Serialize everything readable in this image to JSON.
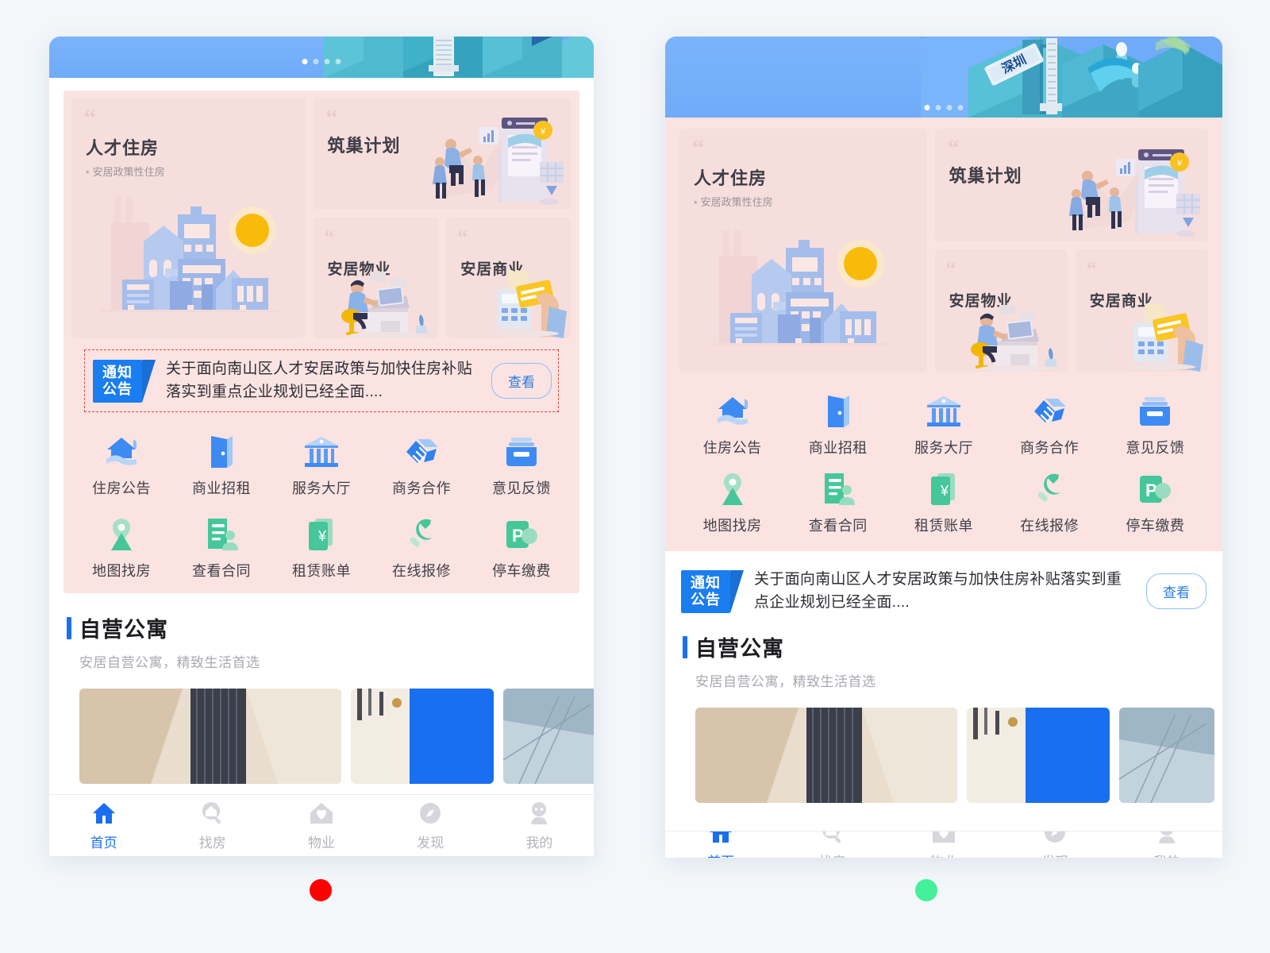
{
  "page": {
    "background": "#f3f7fa",
    "accent_blue": "#1a6ef0",
    "promo_pink": "#fbe3e2",
    "card_pink": "#f6dedd"
  },
  "panels": [
    {
      "id": "left",
      "selection_border_color": "#e8443a",
      "status_dot_color": "#fe0000"
    },
    {
      "id": "right",
      "status_dot_color": "#44f09a"
    }
  ],
  "banner": {
    "sign_text": "深圳",
    "dots": [
      "on",
      "off",
      "off",
      "off"
    ],
    "dot_count": 4
  },
  "promo": {
    "quote_mark": "“",
    "cards": [
      {
        "title": "人才住房",
        "subtitle": "安居政策性住房",
        "art": "cityscape-illustration"
      },
      {
        "title": "筑巢计划",
        "subtitle": "",
        "art": "teamwork-growth-illustration"
      },
      {
        "title": "安居物业",
        "subtitle": "",
        "art": "desk-worker-illustration"
      },
      {
        "title": "安居商业",
        "subtitle": "",
        "art": "card-payment-illustration"
      }
    ]
  },
  "notice": {
    "tag_line1": "通知",
    "tag_line2": "公告",
    "text": "关于面向南山区人才安居政策与加快住房补贴落实到重点企业规划已经全面....",
    "button_label": "查看"
  },
  "icon_grid": {
    "items": [
      {
        "label": "住房公告",
        "icon": "house-hand-icon",
        "color": "#3d8bf2"
      },
      {
        "label": "商业招租",
        "icon": "door-icon",
        "color": "#3d8bf2"
      },
      {
        "label": "服务大厅",
        "icon": "bank-icon",
        "color": "#5a9cf5"
      },
      {
        "label": "商务合作",
        "icon": "handshake-icon",
        "color": "#3d8bf2"
      },
      {
        "label": "意见反馈",
        "icon": "inbox-icon",
        "color": "#3d8bf2"
      },
      {
        "label": "地图找房",
        "icon": "map-pin-icon",
        "color": "#45c79a"
      },
      {
        "label": "查看合同",
        "icon": "contract-icon",
        "color": "#45c79a"
      },
      {
        "label": "租赁账单",
        "icon": "bill-yuan-icon",
        "color": "#45c79a"
      },
      {
        "label": "在线报修",
        "icon": "wrench-icon",
        "color": "#45c79a"
      },
      {
        "label": "停车缴费",
        "icon": "parking-icon",
        "color": "#45c79a"
      }
    ]
  },
  "section": {
    "title": "自营公寓",
    "subtitle": "安居自营公寓，精致生活首选"
  },
  "tabbar": {
    "items": [
      {
        "label": "首页",
        "icon": "home-icon",
        "active": true
      },
      {
        "label": "找房",
        "icon": "search-home-icon",
        "active": false
      },
      {
        "label": "物业",
        "icon": "house-heart-icon",
        "active": false
      },
      {
        "label": "发现",
        "icon": "compass-icon",
        "active": false
      },
      {
        "label": "我的",
        "icon": "person-icon",
        "active": false
      }
    ]
  }
}
